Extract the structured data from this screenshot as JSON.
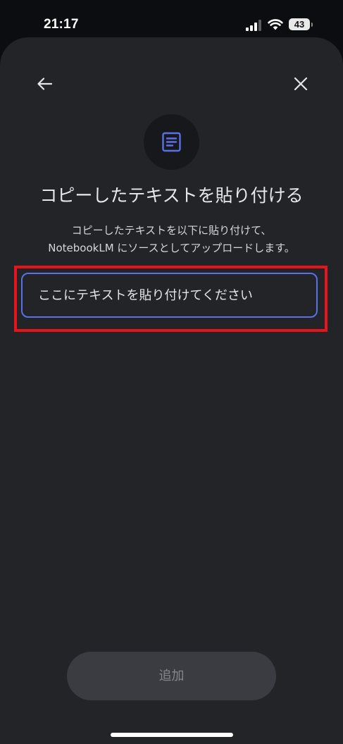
{
  "status_bar": {
    "time": "21:17",
    "battery": "43",
    "signal_icon": "cellular-signal-icon",
    "wifi_icon": "wifi-icon"
  },
  "header": {
    "back_icon": "arrow-left-icon",
    "close_icon": "close-icon"
  },
  "hero": {
    "icon": "document-icon",
    "title": "コピーしたテキストを貼り付ける",
    "description_line1": "コピーしたテキストを以下に貼り付けて、",
    "description_line2": "NotebookLM にソースとしてアップロードします。"
  },
  "input": {
    "placeholder": "ここにテキストを貼り付けてください",
    "value": ""
  },
  "footer": {
    "add_label": "追加"
  },
  "colors": {
    "sheet": "#222428",
    "accent": "#5b6fe6",
    "highlight": "#e8141b",
    "button_disabled": "#3a3c41"
  }
}
